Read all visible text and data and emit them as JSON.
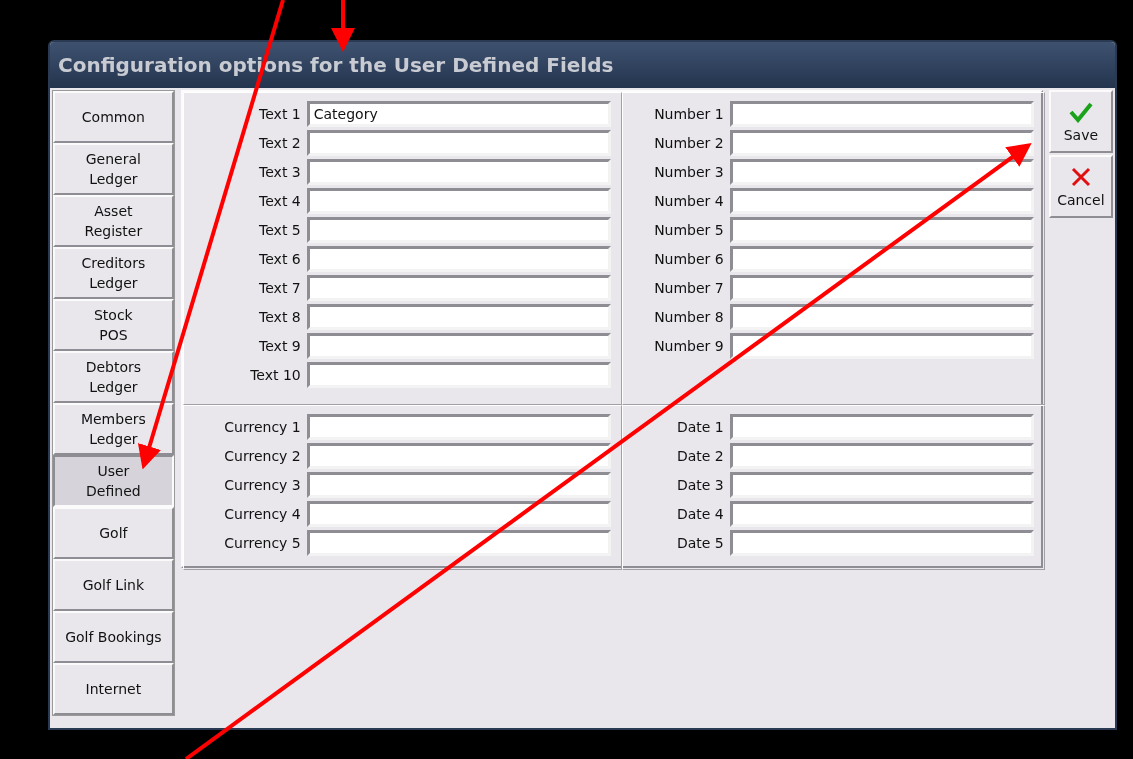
{
  "window": {
    "title": "Configuration options for the User Defined Fields"
  },
  "sidebar": {
    "items": [
      {
        "label": "Common",
        "selected": false
      },
      {
        "label": "General\nLedger",
        "selected": false
      },
      {
        "label": "Asset\nRegister",
        "selected": false
      },
      {
        "label": "Creditors\nLedger",
        "selected": false
      },
      {
        "label": "Stock\nPOS",
        "selected": false
      },
      {
        "label": "Debtors\nLedger",
        "selected": false
      },
      {
        "label": "Members\nLedger",
        "selected": false
      },
      {
        "label": "User\nDefined",
        "selected": true
      },
      {
        "label": "Golf",
        "selected": false
      },
      {
        "label": "Golf Link",
        "selected": false
      },
      {
        "label": "Golf Bookings",
        "selected": false
      },
      {
        "label": "Internet",
        "selected": false
      }
    ]
  },
  "sections": [
    {
      "fields": [
        {
          "label": "Text 1",
          "value": "Category"
        },
        {
          "label": "Text 2"
        },
        {
          "label": "Text 3"
        },
        {
          "label": "Text 4"
        },
        {
          "label": "Text 5"
        },
        {
          "label": "Text 6"
        },
        {
          "label": "Text 7"
        },
        {
          "label": "Text 8"
        },
        {
          "label": "Text 9"
        },
        {
          "label": "Text 10"
        }
      ]
    },
    {
      "fields": [
        {
          "label": "Number 1"
        },
        {
          "label": "Number 2"
        },
        {
          "label": "Number 3"
        },
        {
          "label": "Number 4"
        },
        {
          "label": "Number 5"
        },
        {
          "label": "Number 6"
        },
        {
          "label": "Number 7"
        },
        {
          "label": "Number 8"
        },
        {
          "label": "Number 9"
        }
      ]
    },
    {
      "fields": [
        {
          "label": "Currency 1"
        },
        {
          "label": "Currency 2"
        },
        {
          "label": "Currency 3"
        },
        {
          "label": "Currency 4"
        },
        {
          "label": "Currency 5"
        }
      ]
    },
    {
      "fields": [
        {
          "label": "Date 1"
        },
        {
          "label": "Date 2"
        },
        {
          "label": "Date 3"
        },
        {
          "label": "Date 4"
        },
        {
          "label": "Date 5"
        }
      ]
    }
  ],
  "buttons": [
    {
      "kind": "save",
      "label": "Save"
    },
    {
      "kind": "cancel",
      "label": "Cancel"
    }
  ]
}
